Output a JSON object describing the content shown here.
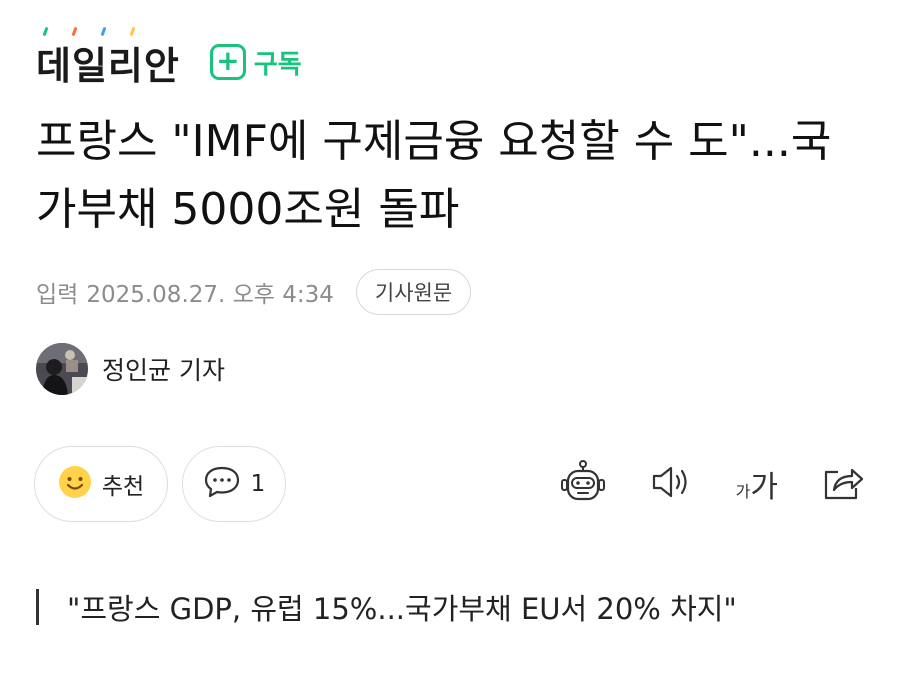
{
  "press": {
    "name": "데일리안",
    "dot_colors": [
      "#19c37d",
      "#ff6b3d",
      "#36a3f7",
      "#ffc83d"
    ],
    "subscribe_symbol": "+",
    "subscribe_label": "구독",
    "accent_color": "#19c37d"
  },
  "article": {
    "headline": "프랑스 \"IMF에 구제금융 요청할 수 도\"...국가부채 5000조원 돌파",
    "input_label": "입력",
    "date": "2025.08.27. 오후 4:34",
    "original_button": "기사원문",
    "reporter": "정인균 기자",
    "subheading": "\"프랑스 GDP, 유럽 15%...국가부채 EU서 20% 차지\""
  },
  "actions": {
    "recommend_label": "추천",
    "comment_count": "1",
    "font_size_small": "가",
    "font_size_large": "가",
    "icons": [
      "smile-icon",
      "comment-icon",
      "robot-icon",
      "speaker-icon",
      "font-size-icon",
      "share-icon"
    ]
  }
}
